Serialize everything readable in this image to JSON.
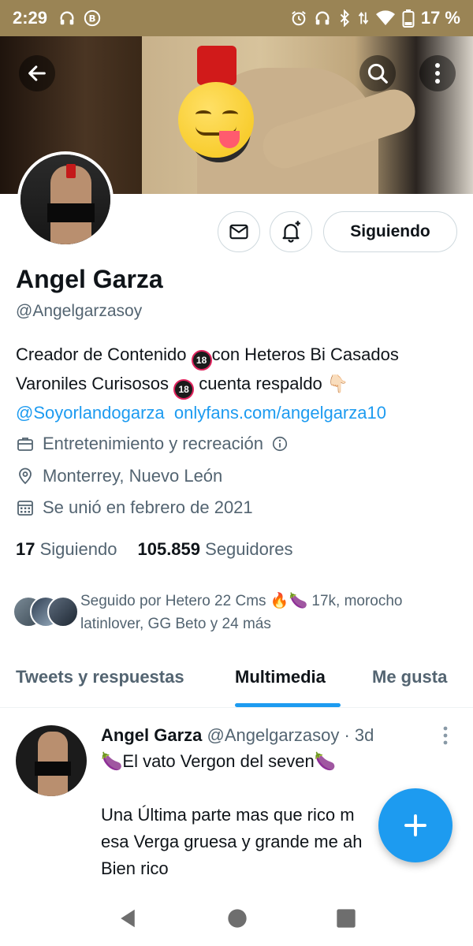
{
  "status_bar": {
    "time": "2:29",
    "battery": "17 %",
    "icons_left": [
      "headphones-icon",
      "b-badge-icon"
    ],
    "icons_right": [
      "alarm-icon",
      "headphones-icon",
      "bluetooth-icon",
      "data-arrows-icon",
      "wifi-icon",
      "battery-icon"
    ]
  },
  "header": {
    "back_icon": "arrow-left-icon",
    "search_icon": "search-icon",
    "more_icon": "more-vertical-icon"
  },
  "profile": {
    "name": "Angel Garza",
    "handle": "@Angelgarzasoy",
    "bio_line1_a": "Creador de Contenido ",
    "badge18": "18",
    "bio_line1_b": "con Heteros Bi Casados",
    "bio_line2_a": "Varoniles Curisosos ",
    "bio_line2_b": " cuenta respaldo 👇🏻",
    "bio_mention": "@Soyorlandogarza",
    "bio_link": "onlyfans.com/angelgarza10",
    "category": "Entretenimiento y recreación",
    "location": "Monterrey, Nuevo León",
    "joined": "Se unió en febrero de 2021",
    "following_count": "17",
    "following_label": "Siguiendo",
    "followers_count": "105.859",
    "followers_label": "Seguidores",
    "followed_by_line1": "Seguido por Hetero 22 Cms 🔥🍆 17k, morocho",
    "followed_by_line2": "latinlover, GG Beto y 24 más"
  },
  "buttons": {
    "message_icon": "mail-icon",
    "notify_icon": "bell-plus-icon",
    "following_label": "Siguiendo"
  },
  "tabs": [
    {
      "label": "Tweets y respuestas"
    },
    {
      "label": "Multimedia"
    },
    {
      "label": "Me gusta"
    }
  ],
  "tweet": {
    "author": "Angel Garza",
    "handle_time": "@Angelgarzasoy · 3d",
    "line1": "🍆El vato Vergon del seven🍆",
    "line2": "Una Última parte mas que rico m",
    "line3": "esa Verga gruesa y grande me ah",
    "line4": "Bien rico"
  },
  "colors": {
    "accent": "#1d9bf0",
    "text_primary": "#0f1419",
    "text_secondary": "#536471",
    "status_bar": "#9a8455"
  }
}
